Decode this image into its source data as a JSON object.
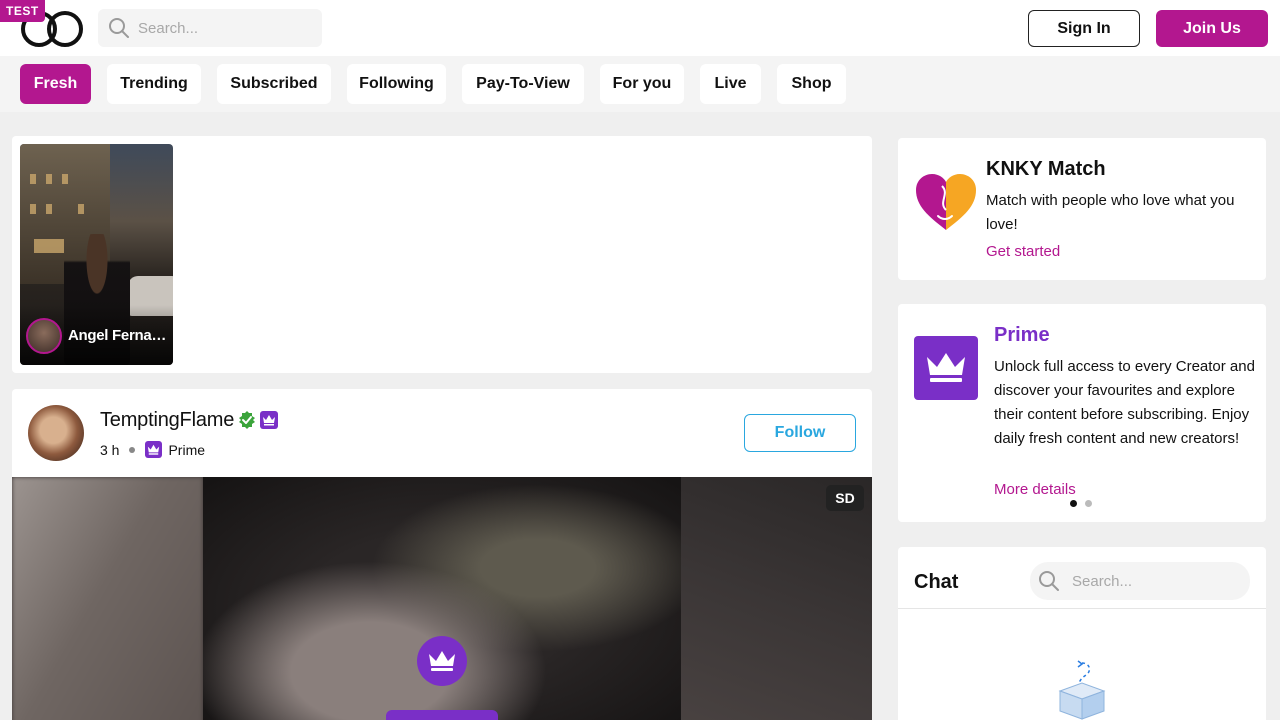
{
  "app": {
    "env_badge": "TEST",
    "logo_icon": "interlocked-rings-icon",
    "brand_color": "#b3178f",
    "prime_color": "#7a2fc7"
  },
  "header": {
    "search_placeholder": "Search...",
    "sign_in_label": "Sign In",
    "join_label": "Join Us"
  },
  "tabs": [
    {
      "label": "Fresh",
      "active": true
    },
    {
      "label": "Trending",
      "active": false
    },
    {
      "label": "Subscribed",
      "active": false
    },
    {
      "label": "Following",
      "active": false
    },
    {
      "label": "Pay-To-View",
      "active": false
    },
    {
      "label": "For you",
      "active": false
    },
    {
      "label": "Live",
      "active": false
    },
    {
      "label": "Shop",
      "active": false
    }
  ],
  "stories": [
    {
      "name": "Angel Fernandez"
    }
  ],
  "post": {
    "author": "TemptingFlame",
    "verified_icon": "verified-check-icon",
    "time": "3 h",
    "tier": "Prime",
    "follow_label": "Follow",
    "quality_badge": "SD",
    "locked_icon": "crown-icon"
  },
  "sidebar": {
    "match": {
      "title": "KNKY Match",
      "description": "Match with people who love what you love!",
      "link": "Get started",
      "icon": "heart-icon"
    },
    "prime": {
      "title": "Prime",
      "description": "Unlock full access to every Creator and discover your favourites and explore their content before subscribing. Enjoy daily fresh content and new creators!",
      "link": "More details",
      "icon": "crown-icon",
      "carousel_active": 1,
      "carousel_total": 2
    },
    "chat": {
      "title": "Chat",
      "search_placeholder": "Search...",
      "empty_icon": "empty-box-icon"
    }
  }
}
